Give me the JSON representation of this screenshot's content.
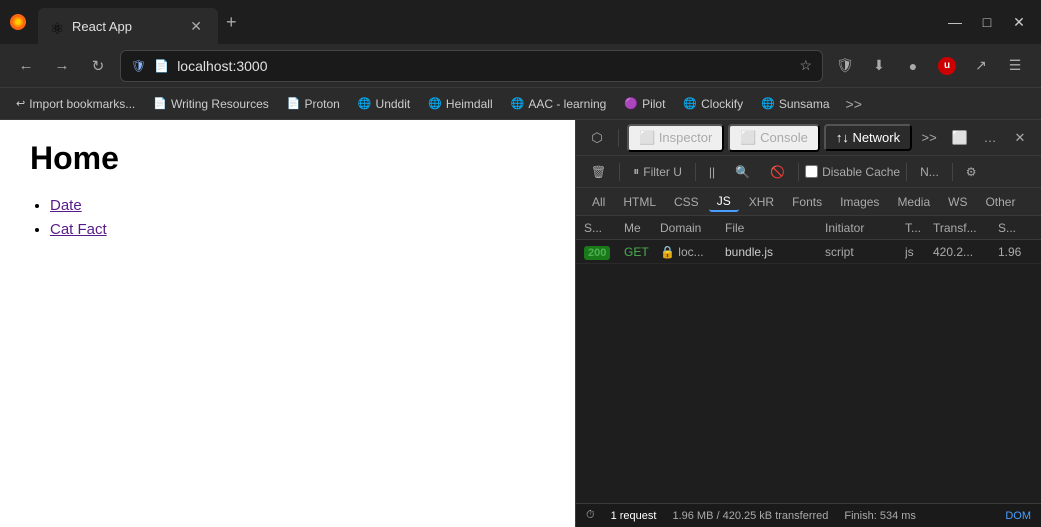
{
  "browser": {
    "tab": {
      "title": "React App",
      "favicon": "⚛"
    },
    "new_tab_icon": "+",
    "window_controls": {
      "minimize": "—",
      "maximize": "□",
      "close": "✕"
    },
    "nav": {
      "back": "←",
      "forward": "→",
      "refresh": "↻",
      "url": "localhost:3000",
      "star": "☆"
    },
    "nav_icons": [
      "🛡",
      "⬇",
      "●",
      "👤",
      "🛡",
      "↗",
      "☰"
    ],
    "bookmarks": [
      {
        "icon": "↩",
        "label": "Import bookmarks..."
      },
      {
        "icon": "📄",
        "label": "Writing Resources"
      },
      {
        "icon": "📄",
        "label": "Proton"
      },
      {
        "icon": "🌐",
        "label": "Unddit"
      },
      {
        "icon": "🌐",
        "label": "Heimdall"
      },
      {
        "icon": "🌐",
        "label": "AAC - learning"
      },
      {
        "icon": "🟣",
        "label": "Pilot"
      },
      {
        "icon": "🌐",
        "label": "Clockify"
      },
      {
        "icon": "🌐",
        "label": "Sunsama"
      }
    ],
    "bookmarks_more": ">>"
  },
  "webpage": {
    "title": "Home",
    "links": [
      {
        "text": "Date",
        "href": "#"
      },
      {
        "text": "Cat Fact",
        "href": "#"
      }
    ]
  },
  "devtools": {
    "toolbar_icons": [
      "⬡",
      "🗑"
    ],
    "tabs": [
      {
        "label": "Inspector",
        "icon": "⬜",
        "active": false
      },
      {
        "label": "Console",
        "icon": "⬜",
        "active": false
      },
      {
        "label": "Network",
        "icon": "↑↓",
        "active": true
      }
    ],
    "more_tabs": ">>",
    "controls": {
      "dock": "⬜",
      "more": "…",
      "close": "✕"
    },
    "network": {
      "toolbar": {
        "clear": "🗑",
        "filter_u": "Filter U",
        "pause": "||",
        "search": "🔍",
        "no_search": "🚫",
        "disable_cache": "Disable Cache",
        "n_label": "N...",
        "settings": "⚙"
      },
      "filter_tabs": [
        "All",
        "HTML",
        "CSS",
        "JS",
        "XHR",
        "Fonts",
        "Images",
        "Media",
        "WS",
        "Other"
      ],
      "active_filter": "JS",
      "columns": [
        "S...",
        "Me",
        "Domain",
        "File",
        "Initiator",
        "T...",
        "Transf...",
        "S..."
      ],
      "rows": [
        {
          "status": "200",
          "method": "GET",
          "domain": "loc...",
          "lock": true,
          "file": "bundle.js",
          "initiator": "script",
          "type": "js",
          "transfer": "420.2...",
          "size": "1.96"
        }
      ]
    },
    "status_bar": {
      "icon": "⏱",
      "requests": "1 request",
      "size": "1.96 MB / 420.25 kB transferred",
      "finish": "Finish: 534 ms",
      "dom": "DOM"
    }
  }
}
